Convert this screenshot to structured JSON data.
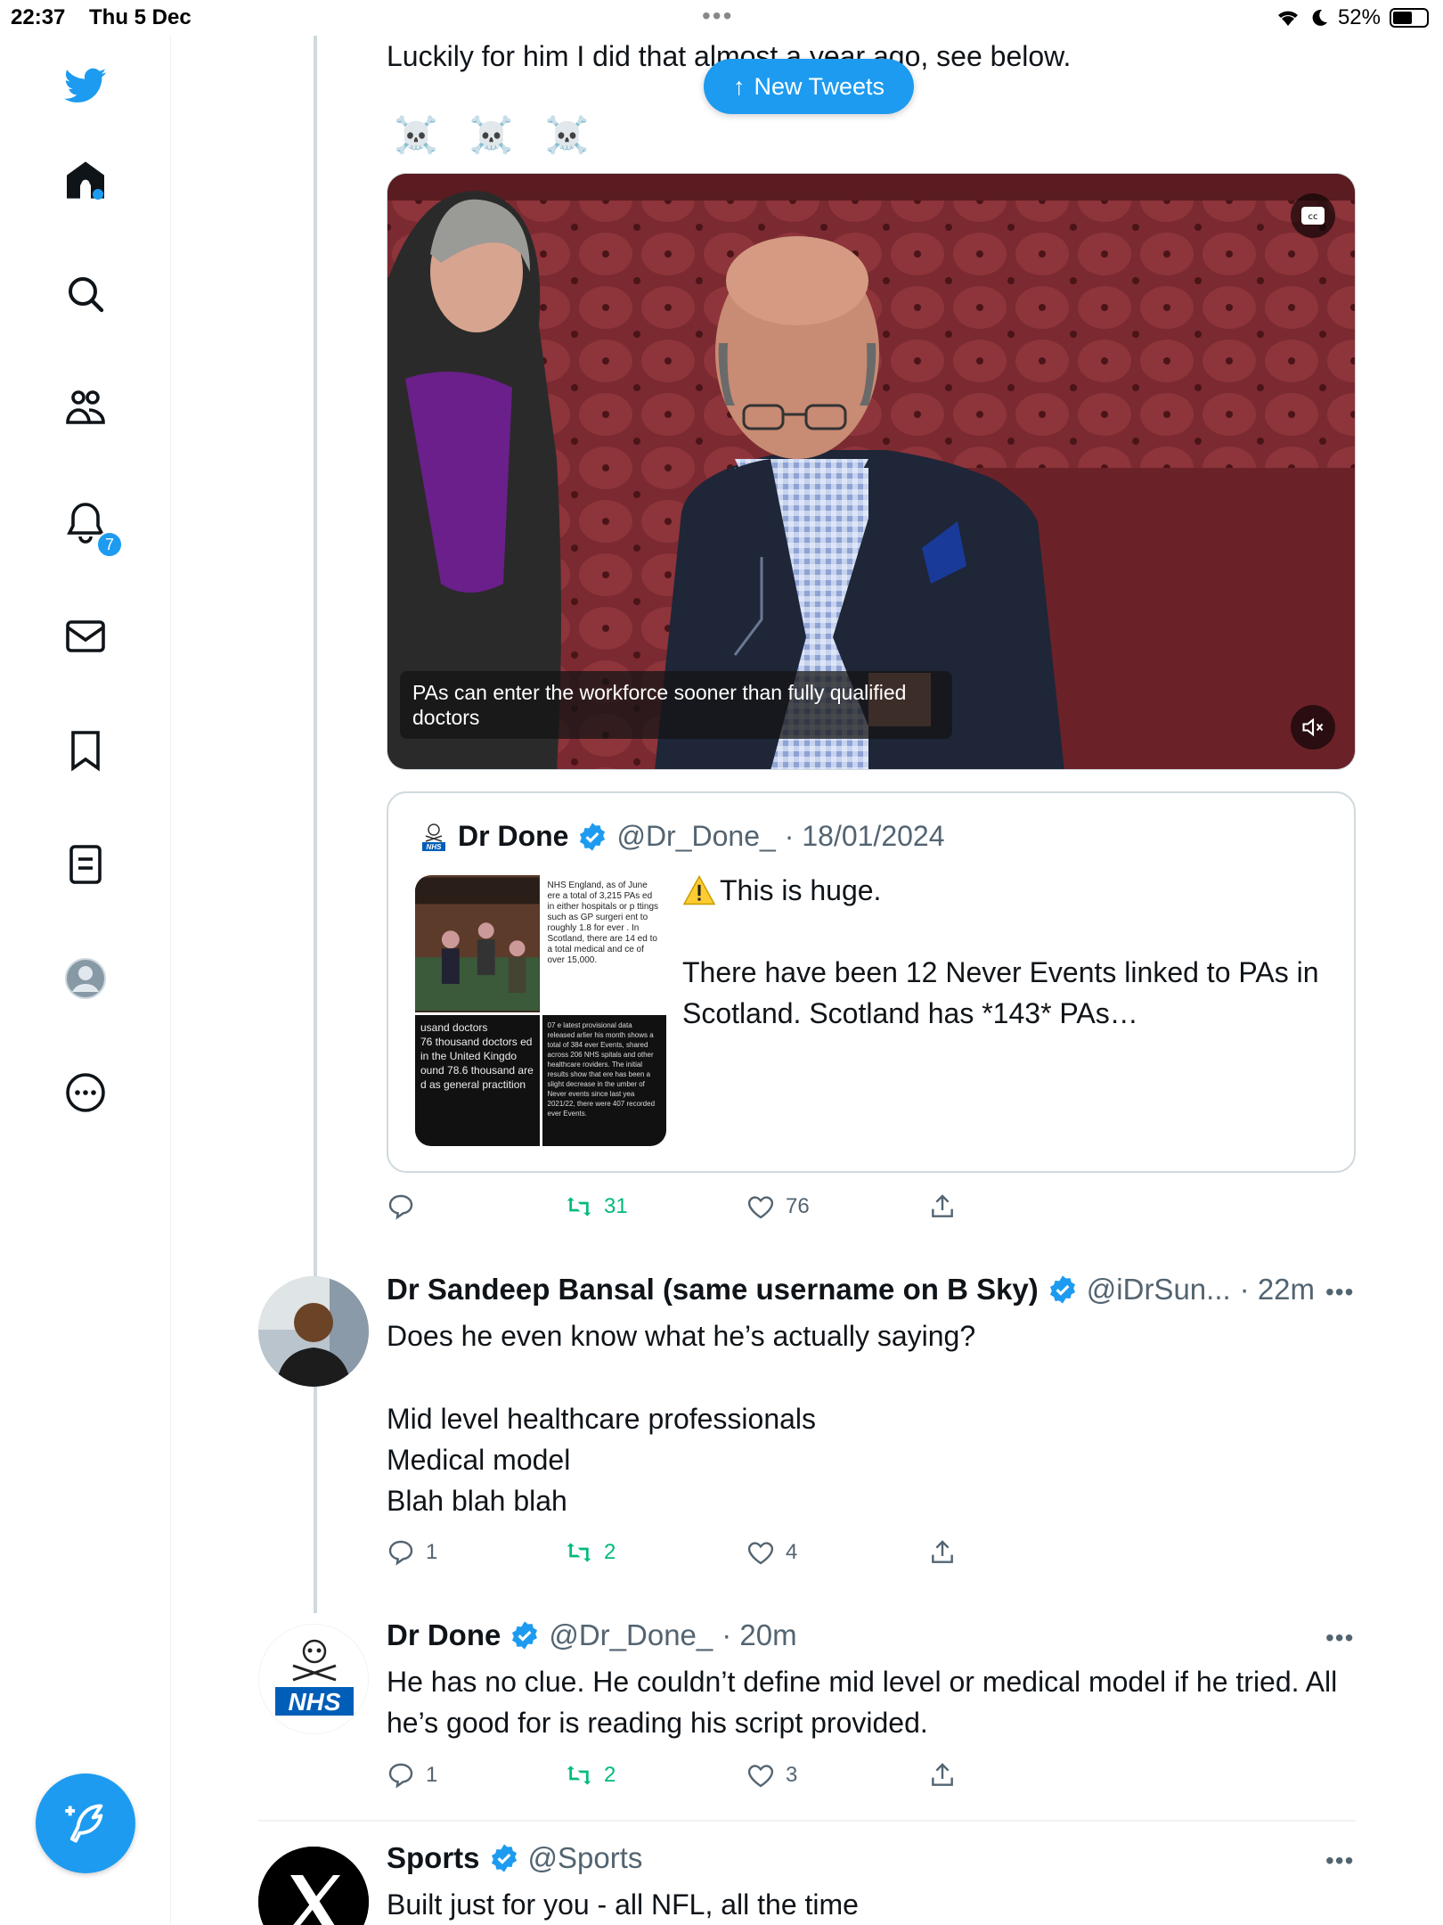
{
  "status_bar": {
    "time": "22:37",
    "date": "Thu 5 Dec",
    "battery": "52%"
  },
  "sidebar": {
    "notifications_count": "7",
    "items": [
      {
        "icon": "twitter-logo-icon"
      },
      {
        "icon": "home-icon"
      },
      {
        "icon": "search-icon"
      },
      {
        "icon": "communities-icon"
      },
      {
        "icon": "notifications-bell-icon"
      },
      {
        "icon": "messages-envelope-icon"
      },
      {
        "icon": "bookmark-icon"
      },
      {
        "icon": "lists-icon"
      },
      {
        "icon": "profile-avatar-icon"
      },
      {
        "icon": "more-circle-icon"
      }
    ],
    "compose_icon": "compose-feather-icon"
  },
  "new_tweets_label": "New Tweets",
  "main_tweet": {
    "text_tail": "Luckily for him I did that almost a year ago, see below.",
    "emojis": "☠️ ☠️ ☠️",
    "video_caption": "PAs can enter the workforce sooner than fully qualified doctors",
    "quote": {
      "name": "Dr Done",
      "handle": "@Dr_Done_",
      "date": "· 18/01/2024",
      "text_line1": "This is huge.",
      "text_line2": "There have been 12 Never Events linked to PAs in Scotland. Scotland has *143* PAs…",
      "image_tiles": {
        "t2": "NHS England, as of June ere a total of 3,215 PAs ed in either hospitals or p ttings such as GP surgeri ent to roughly 1.8 for ever . In Scotland, there are 14 ed to a total medical and ce of over 15,000.",
        "t3": "usand doctors\n76 thousand doctors ed in the United Kingdo ound 78.6 thousand are d as general practition",
        "t4": "07 e latest provisional data released arlier his month shows a total of 384 ever Events, shared across 206 NHS spitals and other healthcare roviders. The initial results show that ere has been a slight decrease in the umber of Never events since last yea 2021/22, there were 407 recorded ever Events."
      }
    },
    "actions": {
      "reply": "",
      "retweet": "31",
      "like": "76"
    }
  },
  "reply1": {
    "name": "Dr Sandeep Bansal (same username on B Sky)",
    "handle": "@iDrSun...",
    "time": "· 22m",
    "line1": "Does he even know what he’s actually saying?",
    "line2": "Mid level healthcare professionals",
    "line3": "Medical model",
    "line4": "Blah blah blah",
    "actions": {
      "reply": "1",
      "retweet": "2",
      "like": "4"
    }
  },
  "reply2": {
    "name": "Dr Done",
    "handle": "@Dr_Done_",
    "time": "· 20m",
    "text": "He has no clue. He couldn’t define mid level or medical model if he tried. All he’s good for is reading his script provided.",
    "avatar_label": "NHS",
    "actions": {
      "reply": "1",
      "retweet": "2",
      "like": "3"
    }
  },
  "promo": {
    "name": "Sports",
    "handle": "@Sports",
    "text": "Built just for you - all NFL, all the time"
  },
  "colors": {
    "accent": "#1d9bf0",
    "retweet": "#00ba7c",
    "muted": "#536471"
  }
}
